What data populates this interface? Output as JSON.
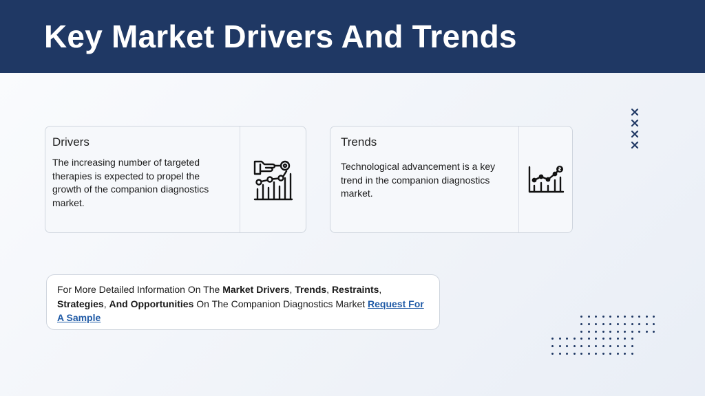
{
  "header": {
    "title": "Key Market Drivers And Trends"
  },
  "drivers": {
    "heading": "Drivers",
    "body": "The increasing number of targeted therapies is expected to propel the growth of the companion diagnostics market.",
    "icon": "hand-chart-icon"
  },
  "trends": {
    "heading": "Trends",
    "body": "Technological advancement is a key trend in the companion diagnostics market.",
    "icon": "growth-chart-dollar-icon"
  },
  "info": {
    "t1": "For More Detailed Information On The ",
    "b1": "Market Drivers",
    "t2": ", ",
    "b2": "Trends",
    "t3": ", ",
    "b3": "Restraints",
    "t4": ", ",
    "b4": "Strategies",
    "t5": ", ",
    "b5": "And Opportunities",
    "t6": " On The Companion Diagnostics Market  ",
    "link": "Request For A Sample"
  },
  "colors": {
    "header_bg": "#1f3864",
    "link": "#1f5aa6"
  },
  "decor": {
    "x_marks_icon": "x-marks-icon",
    "dots_icon": "dot-grid-icon"
  }
}
